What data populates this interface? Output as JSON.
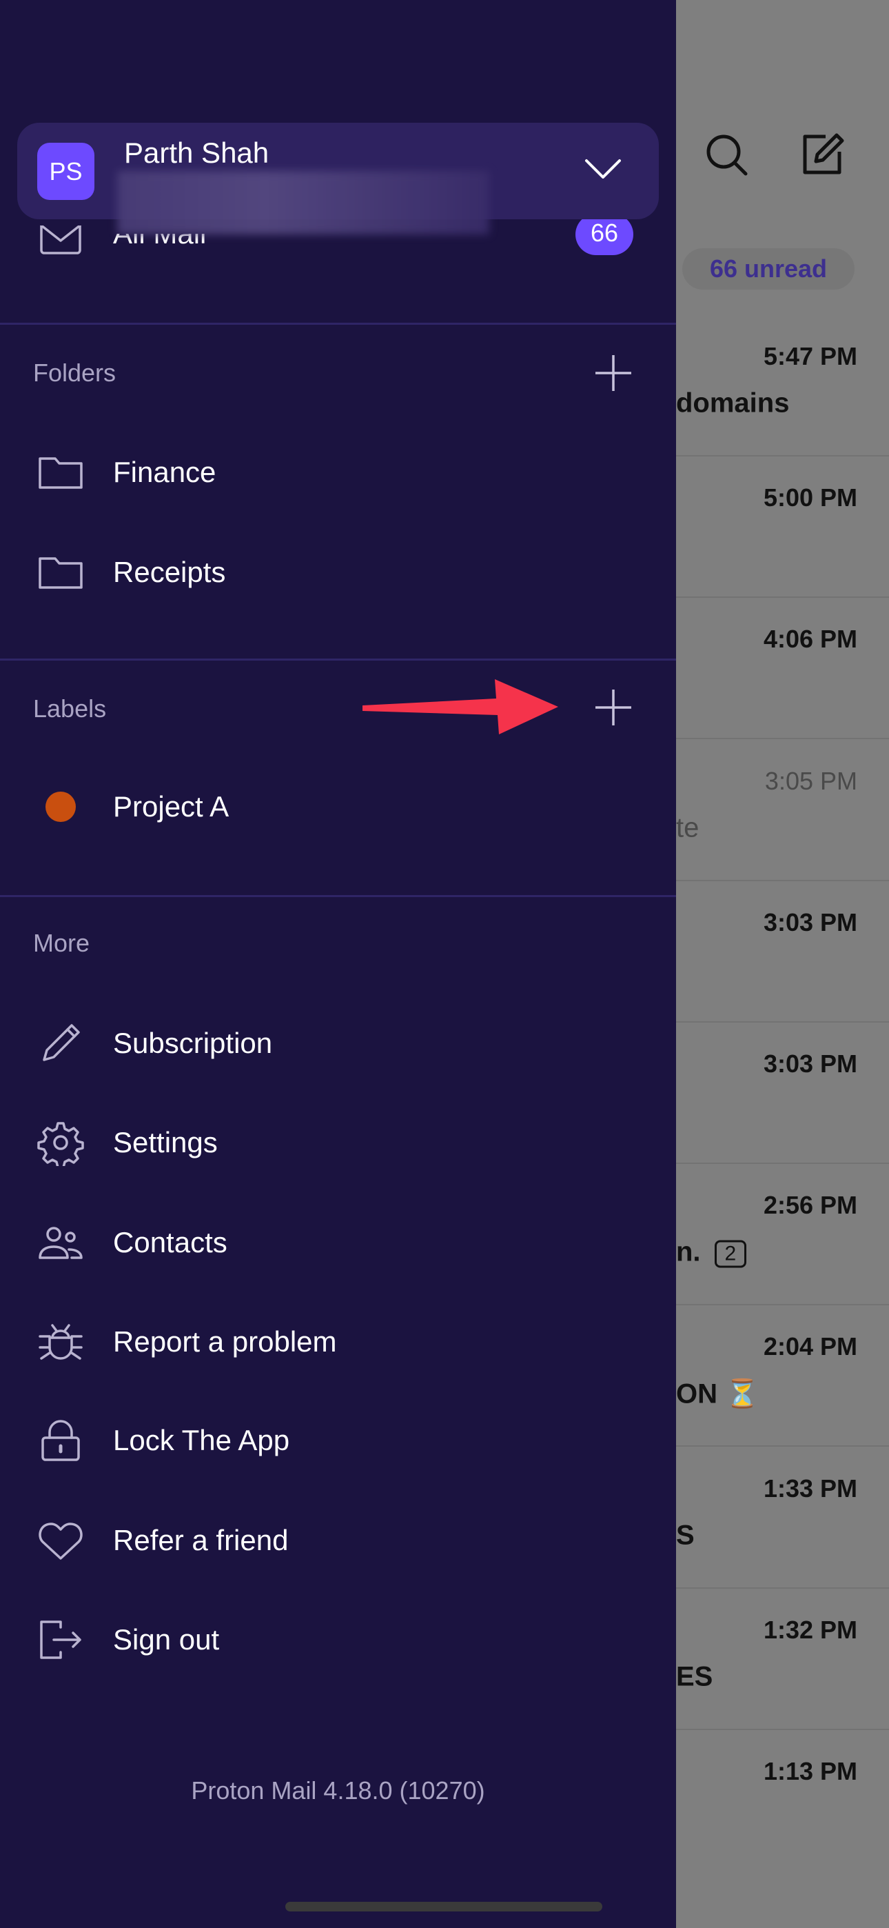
{
  "account": {
    "initials": "PS",
    "name": "Parth Shah"
  },
  "inbox": {
    "label": "All Mail",
    "count": "66"
  },
  "folders": {
    "title": "Folders",
    "items": [
      {
        "label": "Finance"
      },
      {
        "label": "Receipts"
      }
    ]
  },
  "labels": {
    "title": "Labels",
    "items": [
      {
        "label": "Project A",
        "color": "#c94f0f"
      }
    ]
  },
  "more": {
    "title": "More",
    "items": [
      {
        "label": "Subscription",
        "icon": "pencil-icon"
      },
      {
        "label": "Settings",
        "icon": "gear-icon"
      },
      {
        "label": "Contacts",
        "icon": "contacts-icon"
      },
      {
        "label": "Report a problem",
        "icon": "bug-icon"
      },
      {
        "label": "Lock The App",
        "icon": "lock-icon"
      },
      {
        "label": "Refer a friend",
        "icon": "heart-icon"
      },
      {
        "label": "Sign out",
        "icon": "sign-out-icon"
      }
    ]
  },
  "version": "Proton Mail 4.18.0 (10270)",
  "mailbox": {
    "unread": "66 unread",
    "rows": [
      {
        "time": "5:47 PM",
        "subject": "domains"
      },
      {
        "time": "5:00 PM",
        "subject": ""
      },
      {
        "time": "4:06 PM",
        "subject": ""
      },
      {
        "time": "3:05 PM",
        "subject": "te",
        "read": true
      },
      {
        "time": "3:03 PM",
        "subject": ""
      },
      {
        "time": "3:03 PM",
        "subject": ""
      },
      {
        "time": "2:56 PM",
        "subject": "n.",
        "thread_count": "2"
      },
      {
        "time": "2:04 PM",
        "subject": "ON ⏳"
      },
      {
        "time": "1:33 PM",
        "subject": "S"
      },
      {
        "time": "1:32 PM",
        "subject": "ES"
      },
      {
        "time": "1:13 PM",
        "subject": ""
      }
    ]
  },
  "colors": {
    "drawer": "#1b1340",
    "accent": "#6d4aff",
    "arrow": "#f5334b"
  }
}
